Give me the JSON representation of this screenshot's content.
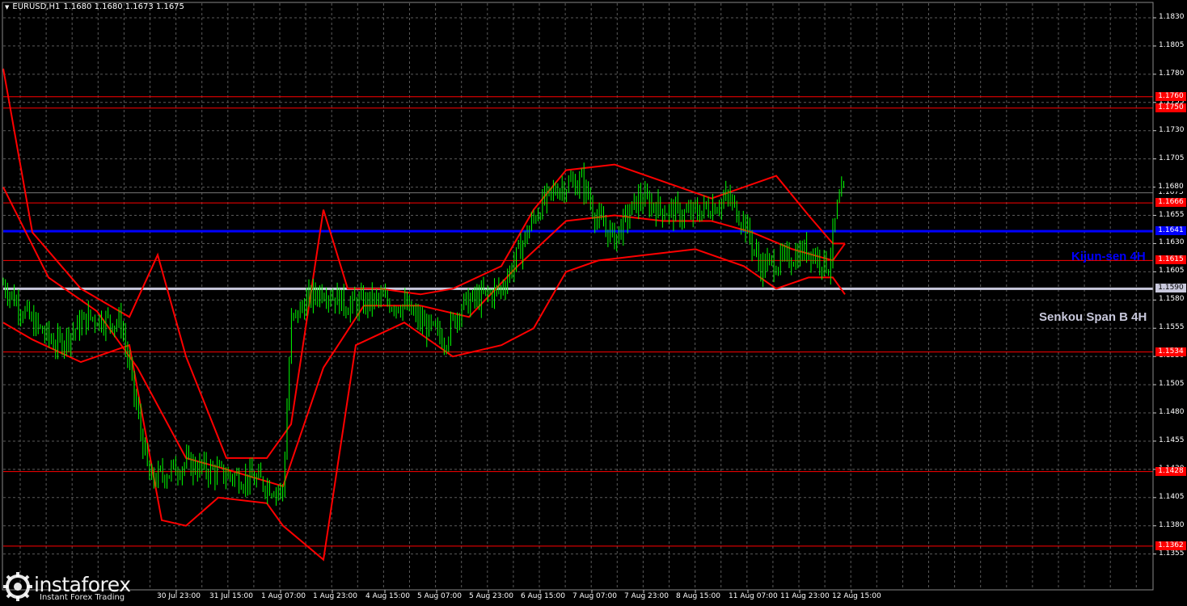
{
  "header": {
    "symbol": "EURUSD,H1",
    "ohlc": "1.1680 1.1680 1.1673 1.1675"
  },
  "price_axis": [
    "1.1830",
    "1.1805",
    "1.1780",
    "1.1755",
    "1.1730",
    "1.1705",
    "1.1680",
    "1.1655",
    "1.1630",
    "1.1605",
    "1.1580",
    "1.1555",
    "1.1530",
    "1.1505",
    "1.1480",
    "1.1455",
    "1.1430",
    "1.1405",
    "1.1380",
    "1.1355"
  ],
  "time_axis": [
    "30 Jul 23:00",
    "31 Jul 15:00",
    "1 Aug 07:00",
    "1 Aug 23:00",
    "4 Aug 15:00",
    "5 Aug 07:00",
    "5 Aug 23:00",
    "6 Aug 15:00",
    "7 Aug 07:00",
    "7 Aug 23:00",
    "8 Aug 15:00",
    "11 Aug 07:00",
    "11 Aug 23:00",
    "12 Aug 15:00"
  ],
  "levels": [
    {
      "price": "1.1760",
      "color": "#ff0000"
    },
    {
      "price": "1.1750",
      "color": "#ff0000"
    },
    {
      "price": "1.1666",
      "color": "#ff0000"
    },
    {
      "price": "1.1615",
      "color": "#ff0000"
    },
    {
      "price": "1.1534",
      "color": "#ff0000"
    },
    {
      "price": "1.1428",
      "color": "#ff0000"
    },
    {
      "price": "1.1362",
      "color": "#ff0000"
    }
  ],
  "kijun": {
    "price": "1.1641",
    "label": "Kijun-sen 4H",
    "color": "#0000ff"
  },
  "senkou": {
    "price": "1.1590",
    "label": "Senkou Span B 4H",
    "color": "#c8c8dc"
  },
  "current_price": "1.1675",
  "current_price_tag": "1.1680",
  "logo": {
    "brand": "instaforex",
    "sub": "Instant Forex Trading"
  },
  "colors": {
    "candles": "#00ff00",
    "bands": "#ff0000",
    "grid": "#5a5a5a",
    "background": "#000000"
  }
}
